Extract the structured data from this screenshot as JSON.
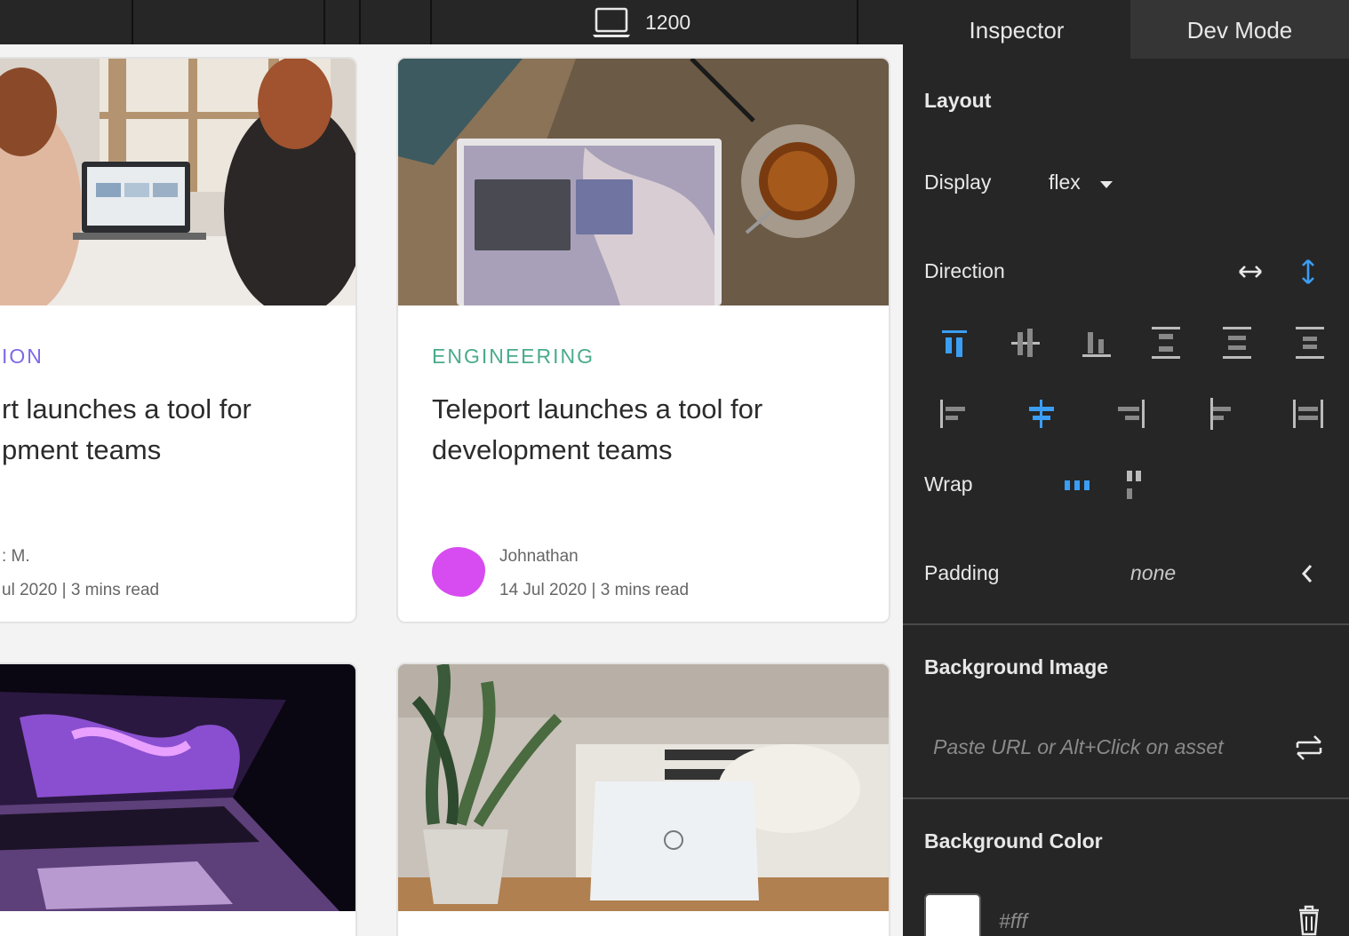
{
  "toolbar": {
    "device_icon": "laptop-icon",
    "width_value": "1200"
  },
  "canvas": {
    "cards": [
      {
        "category": "ION",
        "category_color": "#7d6be6",
        "title_line1": "rt launches a tool for",
        "title_line2": "pment teams",
        "author": ": M.",
        "meta": "ul 2020 | 3 mins read"
      },
      {
        "category": "ENGINEERING",
        "category_color": "#4aab8c",
        "title_line1": "Teleport launches a tool for",
        "title_line2": "development teams",
        "author": "Johnathan",
        "meta": "14 Jul 2020 | 3 mins read",
        "avatar_color": "#d64cf0"
      }
    ]
  },
  "inspector": {
    "tabs": [
      {
        "label": "Inspector",
        "active": true
      },
      {
        "label": "Dev Mode",
        "active": false
      }
    ],
    "layout": {
      "header": "Layout",
      "display_label": "Display",
      "display_value": "flex",
      "direction_label": "Direction",
      "direction_selected": "column",
      "justify_selected": "flex-start",
      "align_selected": "center",
      "wrap_label": "Wrap",
      "wrap_selected": "nowrap",
      "padding_label": "Padding",
      "padding_value": "none"
    },
    "background_image": {
      "header": "Background Image",
      "placeholder": "Paste URL or Alt+Click on asset"
    },
    "background_color": {
      "header": "Background Color",
      "value": "#fff",
      "swatch_color": "#ffffff"
    },
    "accent_color": "#3b9ef5"
  }
}
